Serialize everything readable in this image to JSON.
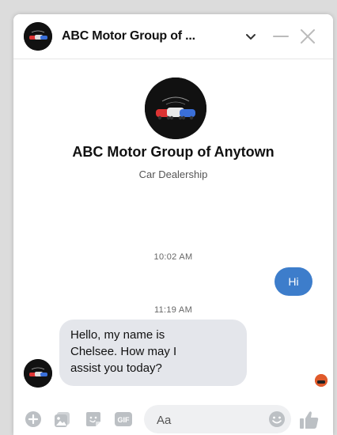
{
  "header": {
    "title": "ABC Motor Group of ...",
    "icons": [
      "chevron-down-icon",
      "minimize-icon",
      "close-icon"
    ]
  },
  "profile": {
    "name": "ABC Motor Group of Anytown",
    "subtitle": "Car Dealership"
  },
  "messages": [
    {
      "timestamp": "10:02 AM",
      "direction": "outgoing",
      "text": "Hi"
    },
    {
      "timestamp": "11:19 AM",
      "direction": "incoming",
      "text": "Hello, my name is\nChelsee. How may I\nassist you today?"
    }
  ],
  "composer": {
    "placeholder": "Aa",
    "icons": [
      "plus-icon",
      "photo-icon",
      "sticker-icon",
      "gif-icon",
      "emoji-icon",
      "thumbs-up-icon"
    ]
  },
  "colors": {
    "outgoing_bubble": "#3d7dcb",
    "incoming_bubble": "#e4e6eb",
    "icon_gray": "#bcc0c4",
    "avatar_bg": "#111111"
  }
}
